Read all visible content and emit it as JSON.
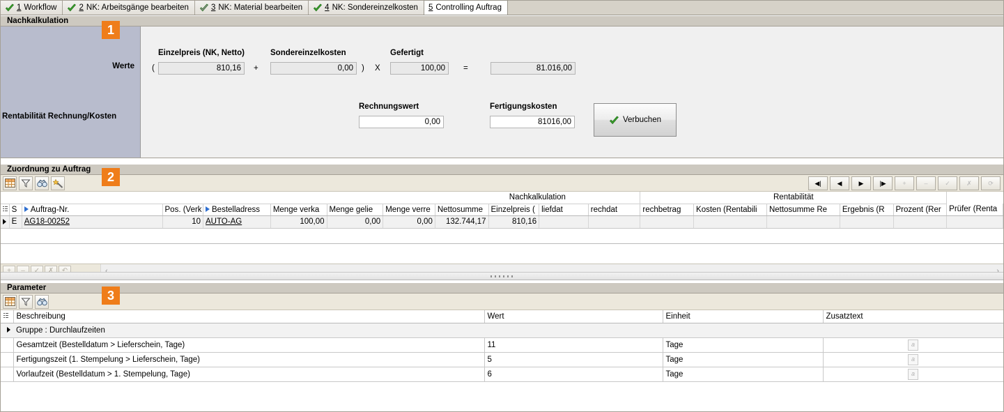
{
  "tabs": [
    {
      "num": "1",
      "label": " Workflow",
      "checked": true,
      "check_color": "#3aa02c",
      "active": false
    },
    {
      "num": "2",
      "label": " NK: Arbeitsgänge bearbeiten",
      "checked": true,
      "check_color": "#3aa02c",
      "active": false
    },
    {
      "num": "3",
      "label": " NK: Material bearbeiten",
      "checked": true,
      "check_color": "#8d8d8d",
      "active": false
    },
    {
      "num": "4",
      "label": " NK: Sondereinzelkosten",
      "checked": true,
      "check_color": "#3aa02c",
      "active": false
    },
    {
      "num": "5",
      "label": " Controlling Auftrag",
      "checked": false,
      "check_color": "",
      "active": true
    }
  ],
  "nachkalkulation": {
    "title": "Nachkalkulation",
    "badge": "1",
    "left_label_werte": "Werte",
    "left_label_rentabilitaet": "Rentabilität Rechnung/Kosten",
    "labels": {
      "einzelpreis": "Einzelpreis (NK, Netto)",
      "sondereinzelkosten": "Sondereinzelkosten",
      "gefertigt": "Gefertigt",
      "rechnungswert": "Rechnungswert",
      "fertigungskosten": "Fertigungskosten"
    },
    "operators": {
      "open": "(",
      "plus": "+",
      "close": ")",
      "times": "X",
      "equals": "="
    },
    "values": {
      "einzelpreis": "810,16",
      "sondereinzelkosten": "0,00",
      "gefertigt": "100,00",
      "result": "81.016,00",
      "rechnungswert": "0,00",
      "fertigungskosten": "81016,00"
    },
    "verbuchen_label": "Verbuchen"
  },
  "zuordnung": {
    "title": "Zuordnung zu Auftrag",
    "badge": "2",
    "toolbar": [
      {
        "name": "grid-layout-icon",
        "title": "Layout"
      },
      {
        "name": "filter-icon",
        "title": "Filter"
      },
      {
        "name": "binoculars-icon",
        "title": "Suchen"
      },
      {
        "name": "wizard-icon",
        "title": "Assistent"
      }
    ],
    "nav": [
      {
        "name": "first-record-button",
        "glyph": "◀|",
        "disabled": false
      },
      {
        "name": "prev-record-button",
        "glyph": "◀",
        "disabled": false
      },
      {
        "name": "next-record-button",
        "glyph": "▶",
        "disabled": false
      },
      {
        "name": "last-record-button",
        "glyph": "|▶",
        "disabled": false
      },
      {
        "name": "insert-record-button",
        "glyph": "+",
        "disabled": true
      },
      {
        "name": "delete-record-button",
        "glyph": "–",
        "disabled": true
      },
      {
        "name": "post-edit-button",
        "glyph": "✓",
        "disabled": true
      },
      {
        "name": "cancel-edit-button",
        "glyph": "✗",
        "disabled": true
      },
      {
        "name": "refresh-button",
        "glyph": "⟳",
        "disabled": true
      }
    ],
    "group_headers": [
      {
        "label": "",
        "span": 8
      },
      {
        "label": "Nachkalkulation",
        "span": 4
      },
      {
        "label": "Rentabilität",
        "span": 5
      }
    ],
    "columns": [
      {
        "label": "",
        "key": "marker",
        "align": "left"
      },
      {
        "label": "S",
        "key": "s",
        "align": "left"
      },
      {
        "label": "Auftrag-Nr.",
        "key": "auftrag",
        "align": "left",
        "sorted": true
      },
      {
        "label": "Pos. (Verk",
        "key": "pos",
        "align": "right"
      },
      {
        "label": "Bestelladress",
        "key": "bestelladresse",
        "align": "left",
        "sorted": true
      },
      {
        "label": "Menge verka",
        "key": "menge_verkauft",
        "align": "right"
      },
      {
        "label": "Menge gelie",
        "key": "menge_geliefert",
        "align": "right"
      },
      {
        "label": "Menge verre",
        "key": "menge_verrechnet",
        "align": "right"
      },
      {
        "label": "Nettosumme",
        "key": "nettosumme",
        "align": "right"
      },
      {
        "label": "Einzelpreis (",
        "key": "einzelpreis",
        "align": "right"
      },
      {
        "label": "liefdat",
        "key": "liefdat",
        "align": "left"
      },
      {
        "label": "rechdat",
        "key": "rechdat",
        "align": "left"
      },
      {
        "label": "rechbetrag",
        "key": "rechbetrag",
        "align": "right"
      },
      {
        "label": "Kosten (Rentabili",
        "key": "kosten",
        "align": "left"
      },
      {
        "label": "Nettosumme Re",
        "key": "nettosumme_rech",
        "align": "left"
      },
      {
        "label": "Ergebnis (R",
        "key": "ergebnis",
        "align": "left"
      },
      {
        "label": "Prozent (Rer",
        "key": "prozent",
        "align": "left"
      },
      {
        "label": "Prüfer (Renta",
        "key": "pruefer",
        "align": "left"
      }
    ],
    "rows": [
      {
        "marker": "▶",
        "s": "E",
        "auftrag": "AG18-00252",
        "pos": "10",
        "bestelladresse": "AUTO-AG",
        "menge_verkauft": "100,00",
        "menge_geliefert": "0,00",
        "menge_verrechnet": "0,00",
        "nettosumme": "132.744,17",
        "einzelpreis": "810,16",
        "liefdat": "",
        "rechdat": "",
        "rechbetrag": "",
        "kosten": "",
        "nettosumme_rech": "",
        "ergebnis": "",
        "prozent": "",
        "pruefer": ""
      }
    ],
    "bottom_buttons": [
      {
        "name": "add-row-button",
        "glyph": "+"
      },
      {
        "name": "remove-row-button",
        "glyph": "–"
      },
      {
        "name": "confirm-row-button",
        "glyph": "✓"
      },
      {
        "name": "cancel-row-button",
        "glyph": "✗"
      },
      {
        "name": "undo-row-button",
        "glyph": "↶"
      }
    ],
    "scroll_left_glyph": "‹",
    "scroll_right_glyph": "›"
  },
  "parameter": {
    "title": "Parameter",
    "badge": "3",
    "toolbar": [
      {
        "name": "grid-layout-icon",
        "title": "Layout"
      },
      {
        "name": "filter-icon",
        "title": "Filter"
      },
      {
        "name": "binoculars-icon",
        "title": "Suchen"
      }
    ],
    "columns": [
      "Beschreibung",
      "Wert",
      "Einheit",
      "Zusatztext"
    ],
    "group_row": "Gruppe : Durchlaufzeiten",
    "rows": [
      {
        "beschreibung": "Gesamtzeit (Bestelldatum > Lieferschein, Tage)",
        "wert": "11",
        "einheit": "Tage",
        "zusatztext": "a"
      },
      {
        "beschreibung": "Fertigungszeit (1. Stempelung > Lieferschein, Tage)",
        "wert": "5",
        "einheit": "Tage",
        "zusatztext": "a"
      },
      {
        "beschreibung": "Vorlaufzeit (Bestelldatum > 1. Stempelung, Tage)",
        "wert": "6",
        "einheit": "Tage",
        "zusatztext": "a"
      }
    ]
  },
  "colors": {
    "badge_orange": "#ef7d1a",
    "left_panel_blue": "#b8bccd",
    "toolbar_beige": "#ece8dc",
    "titlebar_gray": "#cdc9c0",
    "check_green": "#3aa02c",
    "link_underline": "#000000",
    "sort_triangle_blue": "#2f6fd0"
  }
}
